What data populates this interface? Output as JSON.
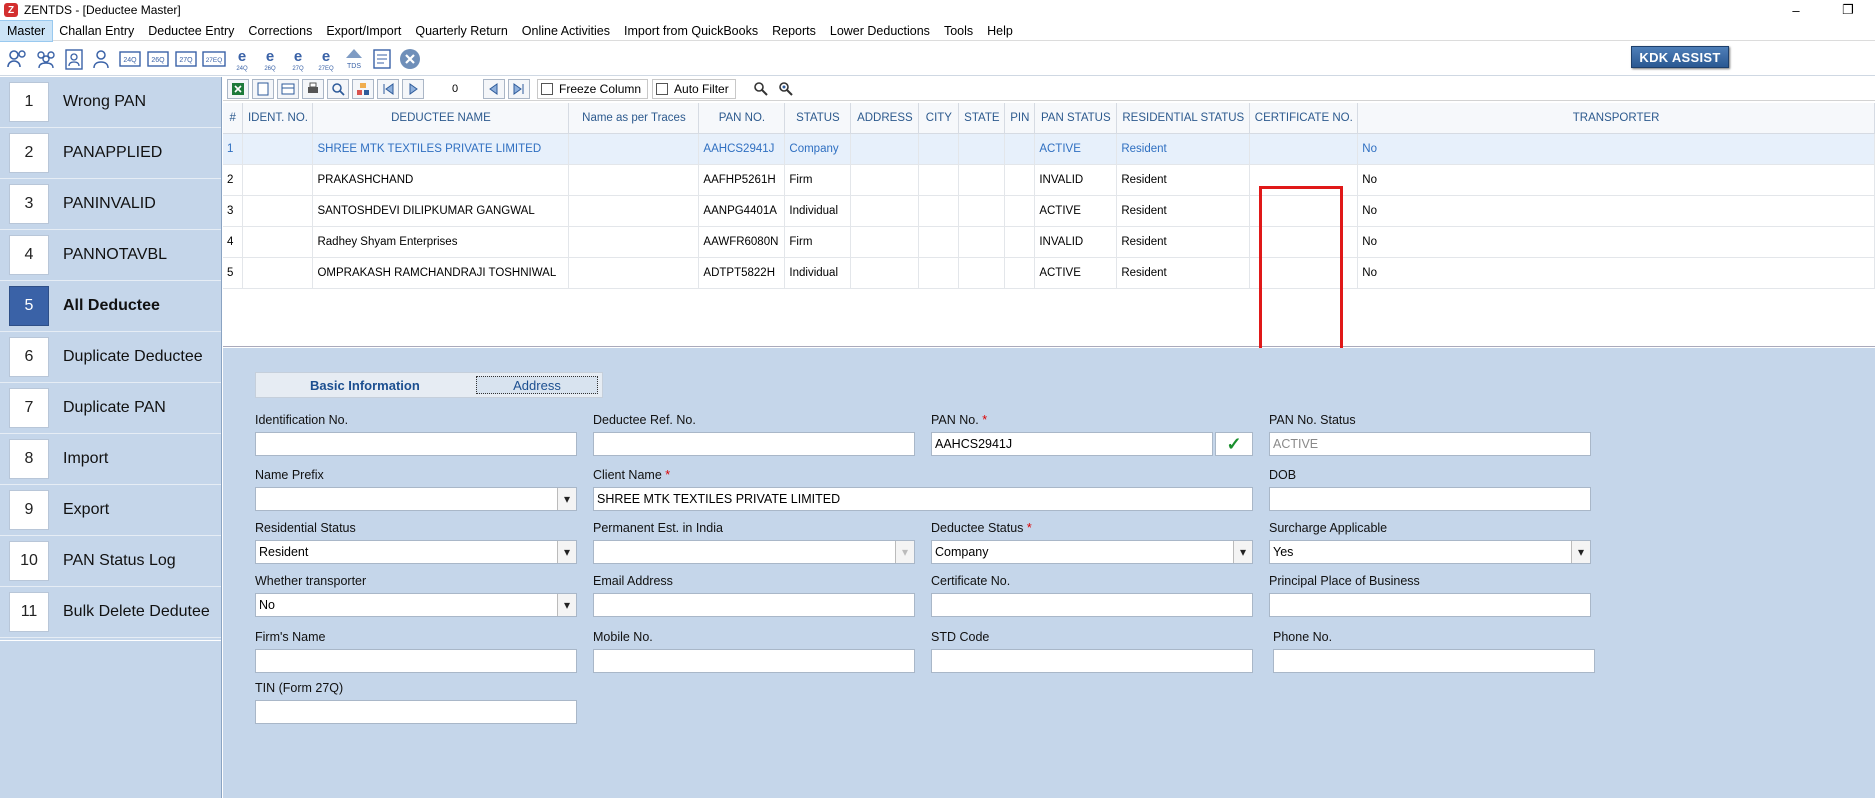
{
  "window": {
    "title": "ZENTDS - [Deductee Master]",
    "app_icon_letter": "Z",
    "minimize": "–",
    "restore": "❐"
  },
  "menu": [
    "Master",
    "Challan Entry",
    "Deductee Entry",
    "Corrections",
    "Export/Import",
    "Quarterly Return",
    "Online Activities",
    "Import from QuickBooks",
    "Reports",
    "Lower Deductions",
    "Tools",
    "Help"
  ],
  "toolbar": {
    "icons": [
      "users-icon",
      "group-icon",
      "user-doc-icon",
      "user-add-icon",
      "24q-doc-icon",
      "26q-doc-icon",
      "27q-doc-icon",
      "27eq-doc-icon",
      "e-24q-icon",
      "e-26q-icon",
      "e-27q-icon",
      "e-27eq-icon",
      "tds-icon",
      "report-icon",
      "close-circle-icon"
    ],
    "kdk_label": "KDK ASSIST"
  },
  "sidebar": [
    {
      "num": "1",
      "label": "Wrong PAN"
    },
    {
      "num": "2",
      "label": "PANAPPLIED"
    },
    {
      "num": "3",
      "label": "PANINVALID"
    },
    {
      "num": "4",
      "label": "PANNOTAVBL"
    },
    {
      "num": "5",
      "label": "All Deductee",
      "active": true
    },
    {
      "num": "6",
      "label": "Duplicate Deductee"
    },
    {
      "num": "7",
      "label": "Duplicate PAN"
    },
    {
      "num": "8",
      "label": "Import"
    },
    {
      "num": "9",
      "label": "Export"
    },
    {
      "num": "10",
      "label": "PAN Status Log"
    },
    {
      "num": "11",
      "label": "Bulk Delete Dedutee"
    }
  ],
  "grid_toolbar": {
    "record_count": "0",
    "freeze_label": "Freeze Column",
    "autofilter_label": "Auto Filter"
  },
  "grid": {
    "columns": [
      "#",
      "IDENT. NO.",
      "DEDUCTEE NAME",
      "Name as per Traces",
      "PAN NO.",
      "STATUS",
      "ADDRESS",
      "CITY",
      "STATE",
      "PIN",
      "PAN STATUS",
      "RESIDENTIAL STATUS",
      "CERTIFICATE NO.",
      "TRANSPORTER"
    ],
    "rows": [
      [
        "1",
        "",
        "SHREE MTK TEXTILES PRIVATE LIMITED",
        "",
        "AAHCS2941J",
        "Company",
        "",
        "",
        "",
        "",
        "ACTIVE",
        "Resident",
        "",
        "No"
      ],
      [
        "2",
        "",
        "PRAKASHCHAND",
        "",
        "AAFHP5261H",
        "Firm",
        "",
        "",
        "",
        "",
        "INVALID",
        "Resident",
        "",
        "No"
      ],
      [
        "3",
        "",
        "SANTOSHDEVI DILIPKUMAR GANGWAL",
        "",
        "AANPG4401A",
        "Individual",
        "",
        "",
        "",
        "",
        "ACTIVE",
        "Resident",
        "",
        "No"
      ],
      [
        "4",
        "",
        "Radhey Shyam Enterprises",
        "",
        "AAWFR6080N",
        "Firm",
        "",
        "",
        "",
        "",
        "INVALID",
        "Resident",
        "",
        "No"
      ],
      [
        "5",
        "",
        "OMPRAKASH RAMCHANDRAJI TOSHNIWAL",
        "",
        "ADTPT5822H",
        "Individual",
        "",
        "",
        "",
        "",
        "ACTIVE",
        "Resident",
        "",
        "No"
      ]
    ],
    "selected_row": 0
  },
  "form": {
    "tabs": {
      "basic": "Basic Information",
      "address": "Address"
    },
    "ident_no": {
      "label": "Identification No.",
      "value": ""
    },
    "ref_no": {
      "label": "Deductee Ref. No.",
      "value": ""
    },
    "pan_no": {
      "label": "PAN No.",
      "required": "*",
      "value": "AAHCS2941J",
      "check": "✓"
    },
    "pan_status": {
      "label": "PAN No. Status",
      "value": "ACTIVE"
    },
    "name_prefix": {
      "label": "Name Prefix",
      "value": ""
    },
    "client_name": {
      "label": "Client Name",
      "required": "*",
      "value": "SHREE MTK TEXTILES PRIVATE LIMITED"
    },
    "dob": {
      "label": "DOB",
      "value": ""
    },
    "residential_status": {
      "label": "Residential Status",
      "value": "Resident"
    },
    "perm_est": {
      "label": "Permanent Est. in India",
      "value": ""
    },
    "deductee_status": {
      "label": "Deductee Status",
      "required": "*",
      "value": "Company"
    },
    "surcharge": {
      "label": "Surcharge Applicable",
      "value": "Yes"
    },
    "transporter": {
      "label": "Whether transporter",
      "value": "No"
    },
    "email": {
      "label": "Email Address",
      "value": ""
    },
    "certificate": {
      "label": "Certificate No.",
      "value": ""
    },
    "principal_place": {
      "label": "Principal Place of Business",
      "value": ""
    },
    "firm_name": {
      "label": "Firm's Name",
      "value": ""
    },
    "mobile": {
      "label": "Mobile No.",
      "value": ""
    },
    "std_code": {
      "label": "STD Code",
      "value": ""
    },
    "phone": {
      "label": "Phone No.",
      "value": ""
    },
    "tin": {
      "label": "TIN (Form 27Q)",
      "value": ""
    }
  },
  "colors": {
    "sidebar_bg": "#c5d6ea",
    "active_num": "#3a62a7",
    "highlight_box": "#e01818",
    "selected_row_text": "#2f6fc1"
  }
}
